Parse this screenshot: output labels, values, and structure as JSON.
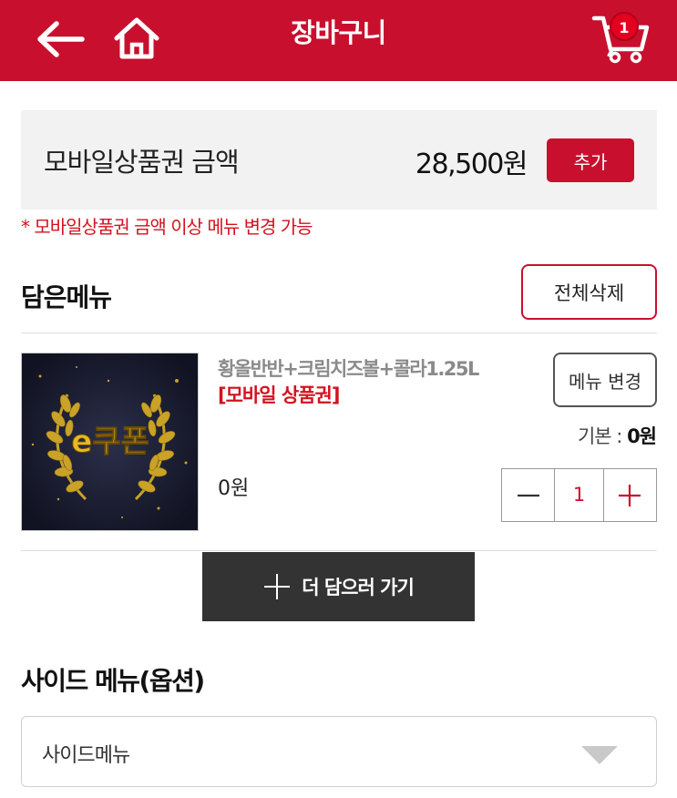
{
  "header": {
    "title": "장바구니",
    "cart_count": "1",
    "back_icon": "arrow-left-icon",
    "home_icon": "home-icon",
    "cart_icon": "cart-icon"
  },
  "gift_certificate": {
    "label": "모바일상품권 금액",
    "amount": "28,500원",
    "add_button": "추가",
    "note": "* 모바일상품권 금액 이상 메뉴 변경 가능"
  },
  "cart": {
    "section_title": "담은메뉴",
    "delete_all_button": "전체삭제",
    "items": [
      {
        "thumb_text": "e쿠폰",
        "name": "황올반반+크림치즈볼+콜라1.25L",
        "tag": "[모바일 상품권]",
        "change_button": "메뉴 변경",
        "base_label": "기본 : ",
        "base_value": "0원",
        "price": "0원",
        "quantity": "1"
      }
    ],
    "more_button": "더 담으러 가기"
  },
  "side_menu": {
    "title": "사이드 메뉴(옵션)",
    "selected": "사이드메뉴"
  },
  "colors": {
    "brand_red": "#c8102e",
    "note_red": "#d3121f",
    "dark_button": "#333333"
  }
}
